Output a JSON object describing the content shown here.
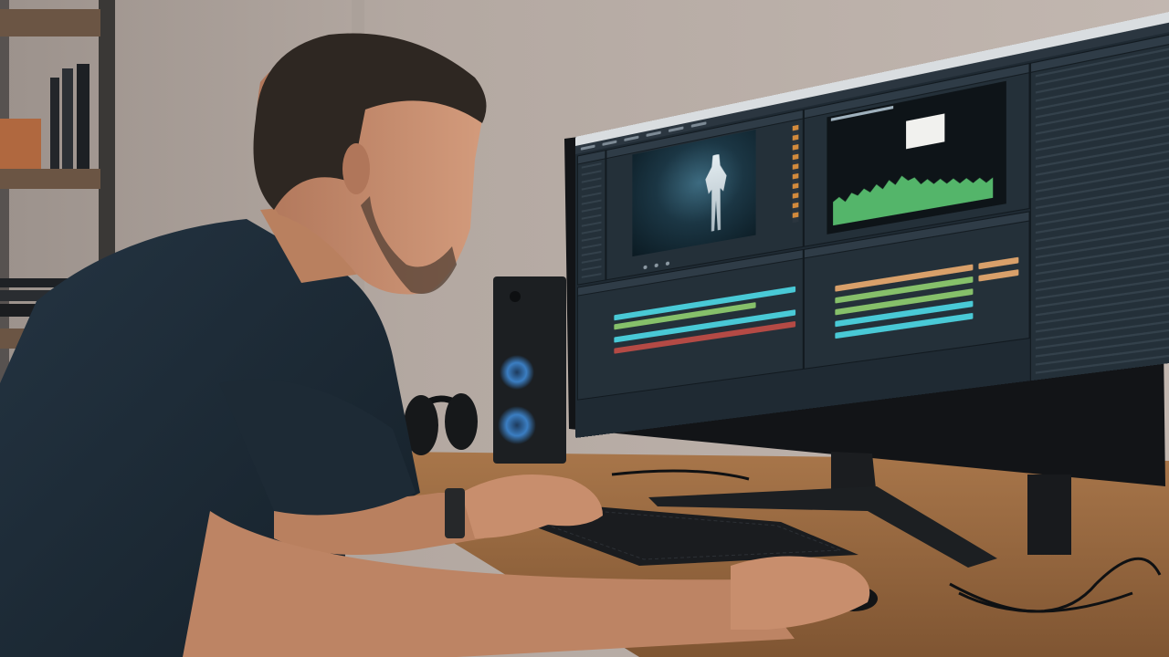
{
  "scene": {
    "description_tags": [
      "person-at-desk",
      "editing-workstation"
    ]
  },
  "screen": {
    "app_panels": [
      "media-browser",
      "source-viewer",
      "program-scope",
      "inspector",
      "timeline",
      "audio-mixer"
    ],
    "colors": {
      "track_cyan": "#49c9d6",
      "track_green": "#86c06a",
      "track_red": "#b44a45",
      "track_orange": "#d9a06a",
      "scope_green": "#54b56a"
    }
  }
}
